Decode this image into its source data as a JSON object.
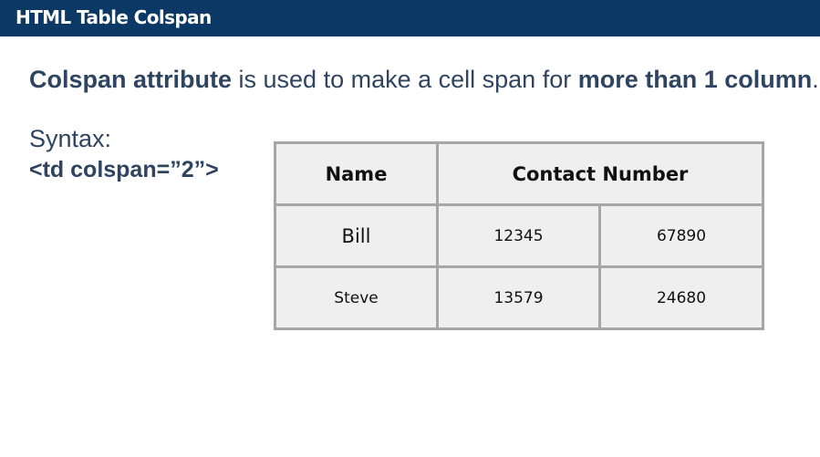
{
  "slide": {
    "title": "HTML Table Colspan",
    "intro": {
      "term": "Colspan attribute",
      "middle": " is used to make a cell span for ",
      "emphasis": "more than 1 column",
      "end": "."
    },
    "syntax_label": "Syntax:",
    "syntax_code": "<td colspan=”2”>"
  },
  "table": {
    "headers": [
      "Name",
      "Contact Number"
    ],
    "rows": [
      [
        "Bill",
        "12345",
        "67890"
      ],
      [
        "Steve",
        "13579",
        "24680"
      ]
    ]
  },
  "colors": {
    "header_bg": "#0c3866",
    "text": "#2e4460",
    "cell_bg": "#efefef",
    "cell_border": "#a6a6a6"
  }
}
